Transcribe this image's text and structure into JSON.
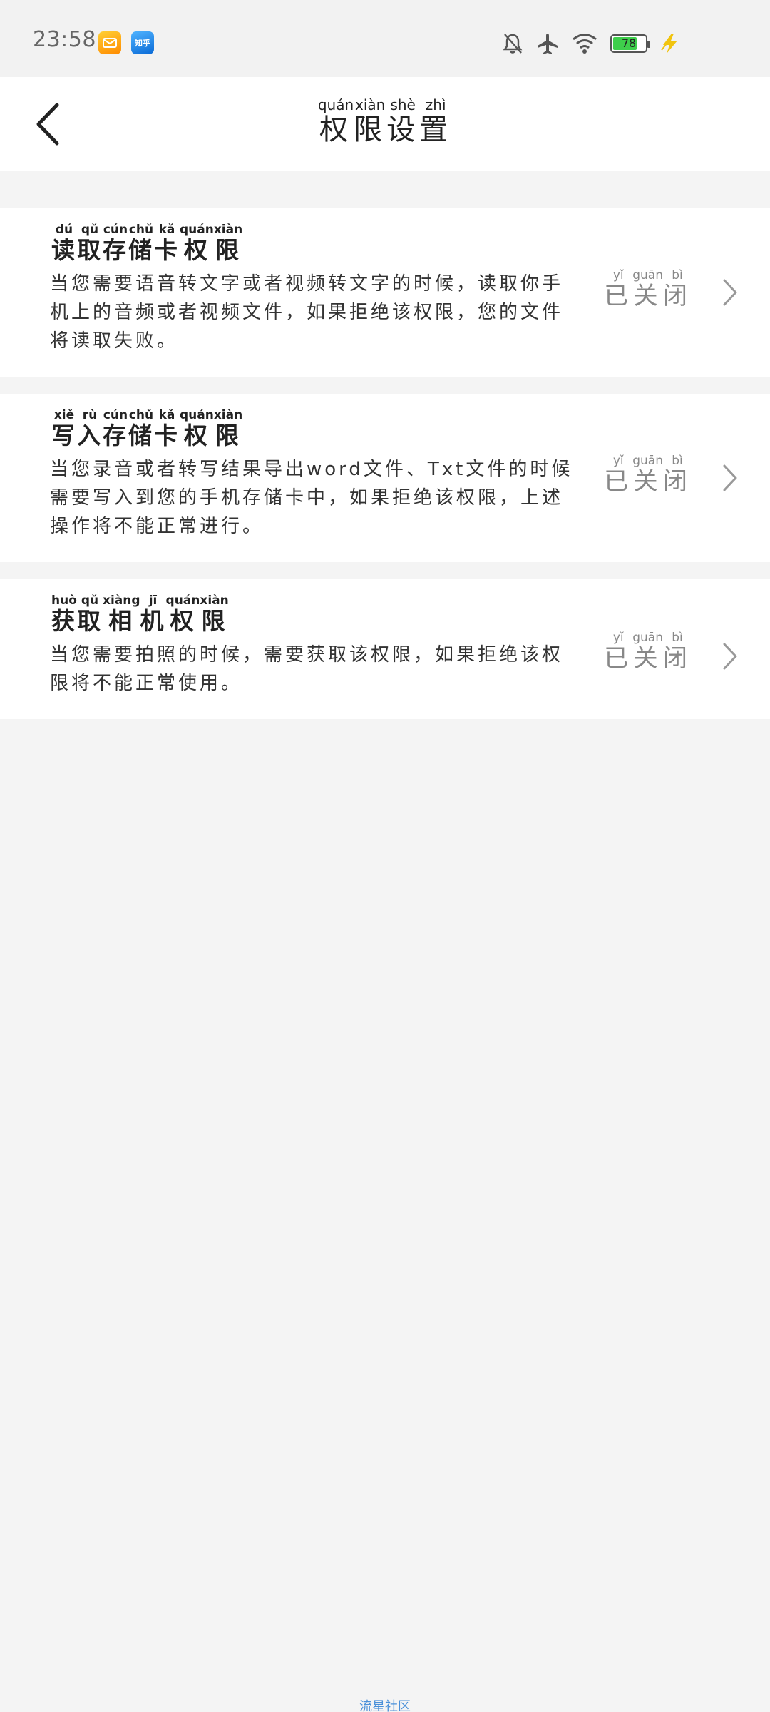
{
  "status_bar": {
    "time": "23:58",
    "battery": "78",
    "battery_level": 0.78,
    "icons": [
      "mail-app-icon",
      "zhihu-app-icon",
      "mute-bell-icon",
      "airplane-icon",
      "wifi-icon",
      "battery-icon",
      "charging-icon"
    ],
    "zhihu_label": "知乎"
  },
  "header": {
    "title": "权限设置",
    "title_pinyin": [
      "quán",
      "xiàn",
      "shè",
      "zhì"
    ]
  },
  "permissions": [
    {
      "title": "读取存储卡权限",
      "title_pinyin": [
        "dú",
        "qǔ",
        "cún",
        "chǔ",
        "kǎ",
        "quán",
        "xiàn"
      ],
      "description": "当您需要语音转文字或者视频转文字的时候，读取你手机上的音频或者视频文件，如果拒绝该权限，您的文件将读取失败。",
      "status": "已关闭",
      "status_pinyin": [
        "yǐ",
        "guān",
        "bì"
      ]
    },
    {
      "title": "写入存储卡权限",
      "title_pinyin": [
        "xiě",
        "rù",
        "cún",
        "chǔ",
        "kǎ",
        "quán",
        "xiàn"
      ],
      "description": "当您录音或者转写结果导出word文件、Txt文件的时候需要写入到您的手机存储卡中，如果拒绝该权限，上述操作将不能正常进行。",
      "status": "已关闭",
      "status_pinyin": [
        "yǐ",
        "guān",
        "bì"
      ]
    },
    {
      "title": "获取相机权限",
      "title_pinyin": [
        "huò",
        "qǔ",
        "xiàng",
        "jī",
        "quán",
        "xiàn"
      ],
      "description": "当您需要拍照的时候，需要获取该权限，如果拒绝该权限将不能正常使用。",
      "status": "已关闭",
      "status_pinyin": [
        "yǐ",
        "guān",
        "bì"
      ]
    }
  ],
  "footer": {
    "link": "流星社区"
  }
}
